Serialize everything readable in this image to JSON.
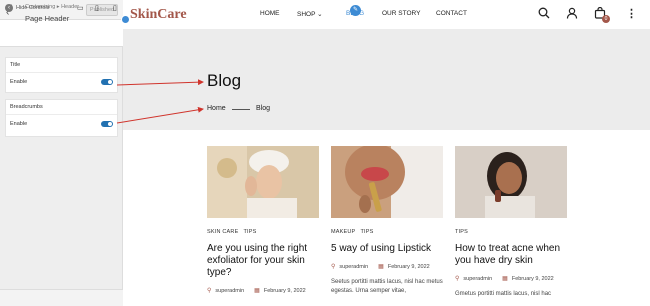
{
  "customizer": {
    "close_icon": "✕",
    "published_label": "Published",
    "breadcrumb": "Customizing ▸ Header",
    "title": "Page Header",
    "title_section": {
      "heading": "Title",
      "row_label": "Enable",
      "enabled": true
    },
    "breadcrumbs_section": {
      "heading": "Breadcrumbs",
      "row_label": "Enable",
      "enabled": true
    },
    "hide_controls_label": "Hide Controls",
    "accent_color": "#2271b1"
  },
  "site": {
    "logo": "SkinCare",
    "brand_color": "#a3574a",
    "nav": {
      "home": "HOME",
      "shop": "SHOP ⌄",
      "blog": "BLOG",
      "our_story": "OUR STORY",
      "contact": "CONTACT"
    },
    "cart_count": "0",
    "page_title": "Blog",
    "breadcrumb_home": "Home",
    "breadcrumb_current": "Blog"
  },
  "posts": [
    {
      "tag1": "SKIN CARE",
      "tag2": "TIPS",
      "title": "Are you using the right exfoliator for your skin type?",
      "author": "superadmin",
      "date": "February 9, 2022",
      "excerpt": ""
    },
    {
      "tag1": "MAKEUP",
      "tag2": "TIPS",
      "title": "5 way of using Lipstick",
      "author": "superadmin",
      "date": "February 9, 2022",
      "excerpt": "Seetus portitti mattis lacus, nisl hac metus egestas. Urna semper vitae,"
    },
    {
      "tag1": "TIPS",
      "tag2": "",
      "title": "How to treat acne when you have dry skin",
      "author": "superadmin",
      "date": "February 9, 2022",
      "excerpt": "Gmetus portitti mattis lacus, nisl hac"
    }
  ]
}
